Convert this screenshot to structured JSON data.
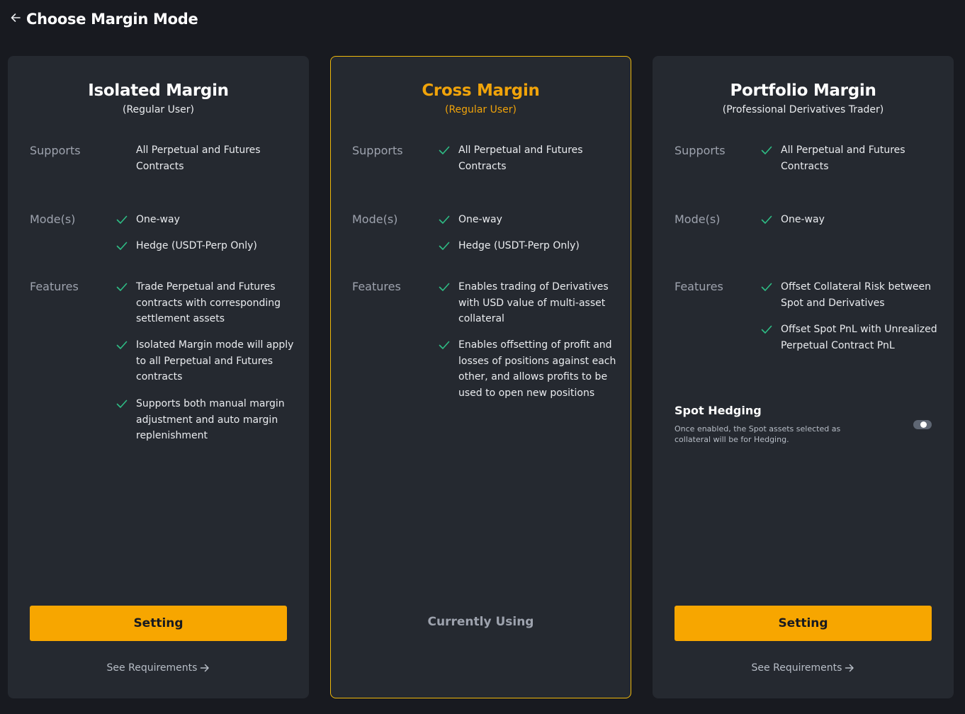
{
  "page": {
    "title": "Choose Margin Mode"
  },
  "labels": {
    "supports": "Supports",
    "modes": "Mode(s)",
    "features": "Features"
  },
  "colors": {
    "accent": "#f7a600",
    "check": "#2ebd85",
    "selected_border": "#f0b90b"
  },
  "cards": [
    {
      "title": "Isolated Margin",
      "subtitle": "(Regular User)",
      "supports": [
        "All Perpetual and Futures Contracts"
      ],
      "modes": [
        "One-way",
        "Hedge (USDT-Perp Only)"
      ],
      "features": [
        "Trade Perpetual and Futures contracts with corresponding settlement assets",
        "Isolated Margin mode will apply to all Perpetual and Futures contracts",
        "Supports both manual margin adjustment and auto margin replenishment"
      ],
      "action_label": "Setting",
      "link_label": "See Requirements"
    },
    {
      "title": "Cross Margin",
      "subtitle": "(Regular User)",
      "supports": [
        "All Perpetual and Futures Contracts"
      ],
      "modes": [
        "One-way",
        "Hedge (USDT-Perp Only)"
      ],
      "features": [
        "Enables trading of Derivatives with USD value of multi-asset collateral",
        "Enables offsetting of profit and losses of positions against each other, and allows profits to be used to open new positions"
      ],
      "status_label": "Currently Using"
    },
    {
      "title": "Portfolio Margin",
      "subtitle": "(Professional Derivatives Trader)",
      "supports": [
        "All Perpetual and Futures Contracts"
      ],
      "modes": [
        "One-way"
      ],
      "features": [
        "Offset Collateral Risk between Spot and Derivatives",
        "Offset Spot PnL with Unrealized Perpetual Contract PnL"
      ],
      "spot_hedging": {
        "title": "Spot Hedging",
        "description": "Once enabled, the Spot assets selected as collateral will be for Hedging."
      },
      "action_label": "Setting",
      "link_label": "See Requirements"
    }
  ]
}
